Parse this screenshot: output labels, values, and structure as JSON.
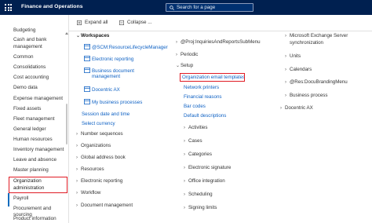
{
  "topbar": {
    "app_title": "Finance and Operations",
    "search_placeholder": "Search for a page"
  },
  "sidebar": {
    "items": [
      "Budgeting",
      "Cash and bank",
      "management",
      "Common",
      "Consolidations",
      "Cost accounting",
      "Demo data",
      "Expense management",
      "Fixed assets",
      "Fleet management",
      "General ledger",
      "Human resources",
      "Inventory management",
      "Leave and absence",
      "Master planning",
      "Organization",
      "administration",
      "Payroll",
      "Procurement and sourcing",
      "Product information"
    ]
  },
  "toolbar": {
    "expand_all": "Expand all",
    "collapse_all": "Collapse ..."
  },
  "col1": {
    "workspaces": "Workspaces",
    "workspace_items": [
      "@SCM:ResourceLifecycleManager",
      "Electronic reporting",
      "Business document",
      "management",
      "Docentric AX",
      "My business processes"
    ],
    "links": [
      "Session date and time",
      "Select currency"
    ],
    "groups": [
      "Number sequences",
      "Organizations",
      "Global address book",
      "Resources",
      "Electronic reporting",
      "Workflow",
      "Document management"
    ]
  },
  "col2": {
    "top_item": "@Proj:InquiriesAndReportsSubMenu",
    "periodic": "Periodic",
    "setup": "Setup",
    "setup_links": [
      "Organization email templates",
      "Network printers",
      "Financial reasons",
      "Bar codes",
      "Default descriptions"
    ],
    "groups": [
      "Activities",
      "Cases",
      "Categories",
      "Electronic signature",
      "Office integration",
      "Scheduling",
      "Signing limits"
    ]
  },
  "col3": {
    "items": [
      "Microsoft Exchange Server",
      "synchronization",
      "Units",
      "Calendars",
      "@Res:DocuBrandingMenu",
      "Business process",
      "Docentric AX"
    ]
  }
}
